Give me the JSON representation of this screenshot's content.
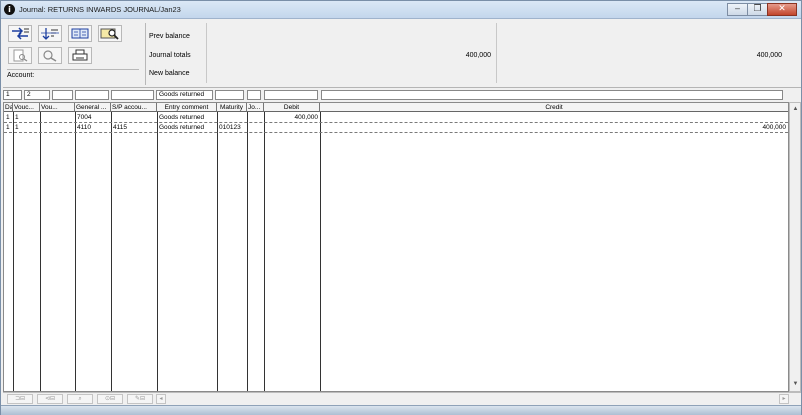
{
  "window": {
    "title": "Journal: RETURNS INWARDS JOURNAL/Jan23",
    "app_icon": "info-circle-icon",
    "controls": {
      "minimize": "‒",
      "maximize": "❐",
      "close": "✕"
    }
  },
  "toolbar": {
    "row1": [
      "transfer-icon",
      "sort-icon",
      "columns-icon",
      "search-card-icon"
    ],
    "row2": [
      "find-document-icon",
      "find-icon",
      "print-icon"
    ],
    "account_label": "Account:"
  },
  "summary": {
    "prev_balance_label": "Prev balance",
    "journal_totals_label": "Journal totals",
    "new_balance_label": "New balance",
    "journal_totals_debit": "400,000",
    "journal_totals_credit": "400,000"
  },
  "entry": {
    "day": "1",
    "voucher": "2",
    "voucher_type": "",
    "general_account": "",
    "sp_account": "",
    "entry_comment": "Goods returned",
    "maturity": "",
    "jo": "",
    "debit": "",
    "credit": ""
  },
  "table": {
    "columns": [
      "Day",
      "Vouc...",
      "Vou...",
      "General ...",
      "S/P accou...",
      "Entry comment",
      "Maturity",
      "Jo...",
      "Debit",
      "Credit"
    ],
    "rows": [
      {
        "day": "1",
        "voucher": "1",
        "voucher_type": "",
        "general_account": "7004",
        "sp_account": "",
        "comment": "Goods returned",
        "maturity": "",
        "jo": "",
        "debit": "400,000",
        "credit": ""
      },
      {
        "day": "1",
        "voucher": "1",
        "voucher_type": "",
        "general_account": "4110",
        "sp_account": "4115",
        "comment": "Goods returned",
        "maturity": "010123",
        "jo": "",
        "debit": "",
        "credit": "400,000"
      }
    ]
  },
  "bottom_tools": [
    "insert-row-icon",
    "delete-row-icon",
    "find-row-icon",
    "view-row-icon",
    "edit-row-icon"
  ],
  "colors": {
    "titlebar": "#c3d6ec",
    "close_button": "#c2452c",
    "grid_background": "#ffffff",
    "window_background": "#f0f0f0"
  }
}
